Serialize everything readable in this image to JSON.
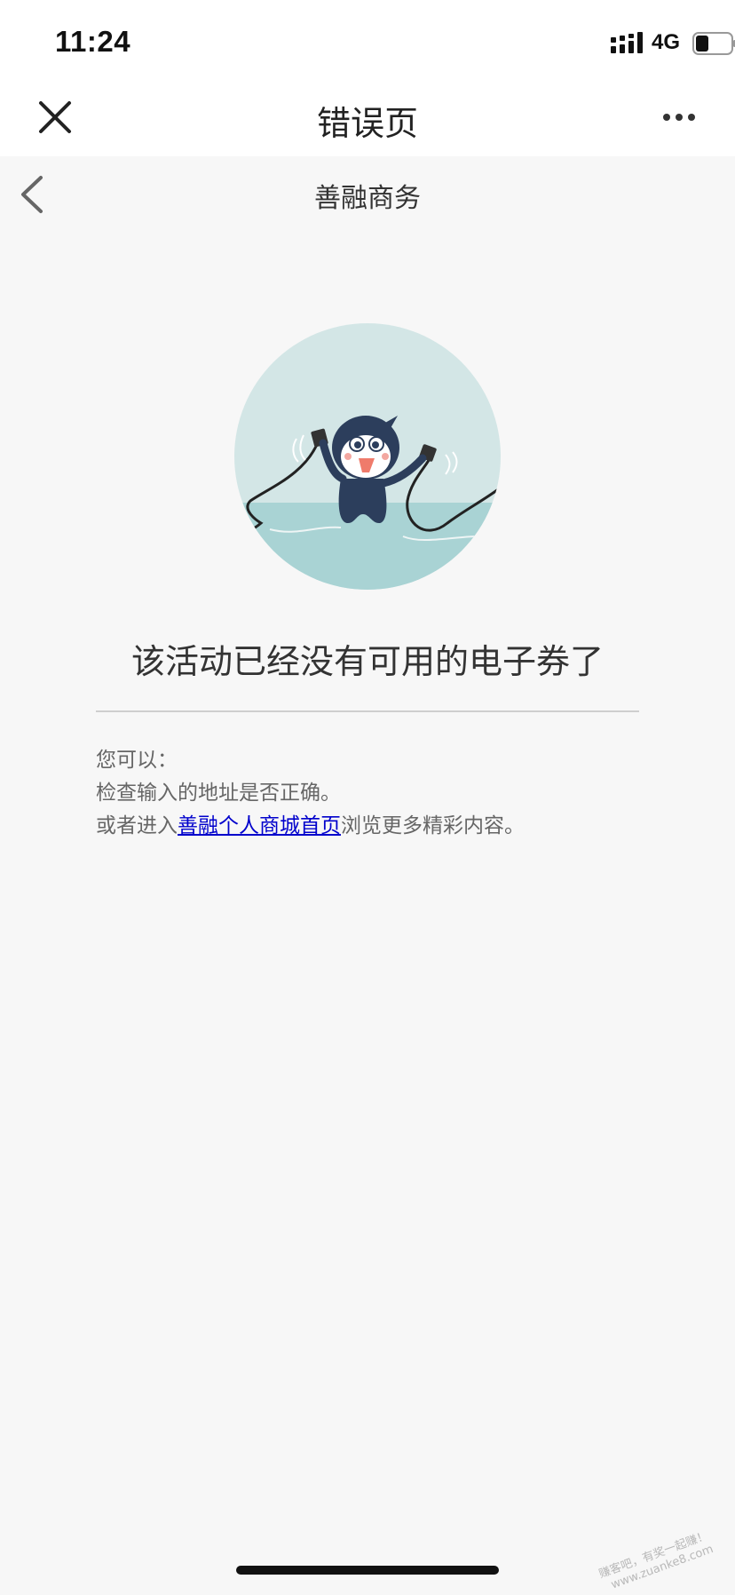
{
  "status_bar": {
    "time": "11:24",
    "network": "4G",
    "signal_icon": "cellular-signal-icon",
    "battery_icon": "battery-icon",
    "battery_level": 0.3
  },
  "nav": {
    "title": "错误页",
    "close_icon": "close-icon",
    "more_icon": "more-icon"
  },
  "sub_header": {
    "title": "善融商务",
    "back_icon": "chevron-left-icon"
  },
  "illustration": {
    "name": "unplugged-mascot-illustration",
    "colors": {
      "circle": "#d3e6e6",
      "ground": "#a9d3d4",
      "mascot": "#2c3e5c"
    }
  },
  "main": {
    "error_message": "该活动已经没有可用的电子券了",
    "tips_heading": "您可以：",
    "tip_1": "检查输入的地址是否正确。",
    "tip_2_prefix": "或者进入",
    "tip_2_link": "善融个人商城首页",
    "tip_2_suffix": "浏览更多精彩内容。"
  },
  "watermark": {
    "line1": "赚客吧，有奖一起赚！",
    "line2": "www.zuanke8.com"
  },
  "colors": {
    "link": "#0000cc",
    "background": "#f7f7f7",
    "header": "#ffffff"
  }
}
